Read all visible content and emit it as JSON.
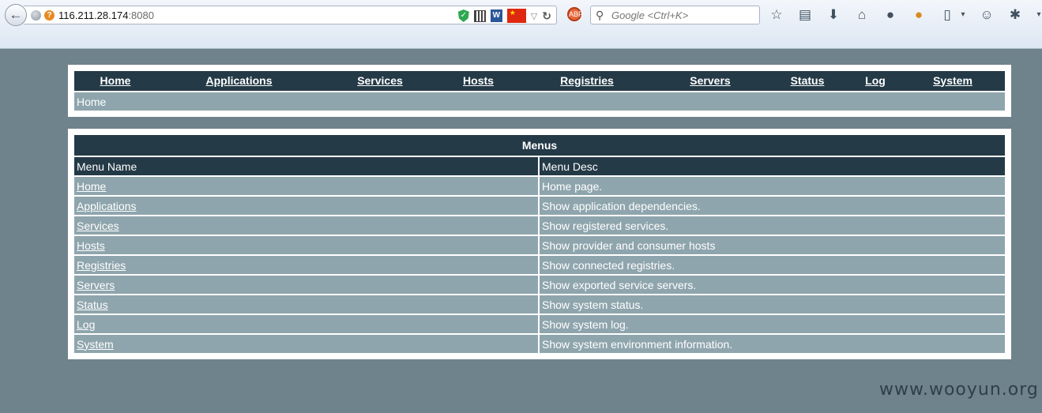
{
  "browser": {
    "url_host": "116.211.28.174",
    "url_port": ":8080",
    "search_placeholder": "Google <Ctrl+K>"
  },
  "nav": {
    "items": [
      "Home",
      "Applications",
      "Services",
      "Hosts",
      "Registries",
      "Servers",
      "Status",
      "Log",
      "System"
    ],
    "breadcrumb": "Home"
  },
  "menus": {
    "title": "Menus",
    "columns": [
      "Menu Name",
      "Menu Desc"
    ],
    "rows": [
      {
        "name": "Home",
        "desc": "Home page."
      },
      {
        "name": "Applications",
        "desc": "Show application dependencies."
      },
      {
        "name": "Services",
        "desc": "Show registered services."
      },
      {
        "name": "Hosts",
        "desc": "Show provider and consumer hosts"
      },
      {
        "name": "Registries",
        "desc": "Show connected registries."
      },
      {
        "name": "Servers",
        "desc": "Show exported service servers."
      },
      {
        "name": "Status",
        "desc": "Show system status."
      },
      {
        "name": "Log",
        "desc": "Show system log."
      },
      {
        "name": "System",
        "desc": "Show system environment information."
      }
    ]
  },
  "watermark": "www.wooyun.org",
  "colors": {
    "page_bg": "#6f838c",
    "header_bg": "#243a47",
    "row_bg": "#8fa5ad"
  }
}
